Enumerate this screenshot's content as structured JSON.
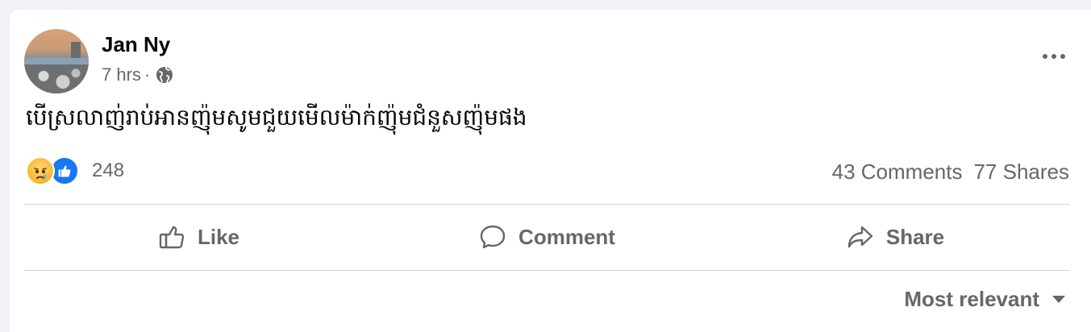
{
  "post": {
    "author": "Jan Ny",
    "time": "7 hrs",
    "separator": "·",
    "privacy_icon": "globe-icon",
    "text": "បើស្រលាញ់រាប់អានញ៉ុមសូមជួយមើលម៉ាក់ញ៉ុមជំនួសញ៉ុមផង"
  },
  "reactions": {
    "icons": [
      "sad-reaction-icon",
      "like-reaction-icon"
    ],
    "count": "248"
  },
  "stats": {
    "comments": "43 Comments",
    "shares": "77 Shares"
  },
  "actions": {
    "like_label": "Like",
    "comment_label": "Comment",
    "share_label": "Share"
  },
  "comments_sort": {
    "label": "Most relevant"
  },
  "colors": {
    "page_bg": "#f0f2f5",
    "card_bg": "#ffffff",
    "secondary_text": "#65676b",
    "like_blue": "#1877f2",
    "sad_yellow": "#f7b125"
  }
}
